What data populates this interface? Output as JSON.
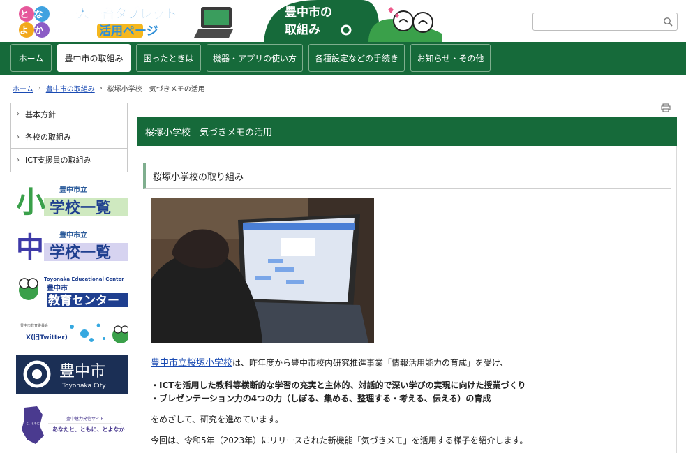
{
  "header": {
    "logo_left_top": "とな",
    "logo_left_bottom": "よか",
    "logo_main_top": "一人一台タブレット",
    "logo_main_bottom": "活用ページ",
    "badge_line1": "豊中市の",
    "badge_line2": "取組み",
    "search": {
      "value": "",
      "placeholder": ""
    }
  },
  "nav": {
    "items": [
      {
        "label": "ホーム"
      },
      {
        "label": "豊中市の取組み"
      },
      {
        "label": "困ったときは"
      },
      {
        "label": "機器・アプリの使い方"
      },
      {
        "label": "各種設定などの手続き"
      },
      {
        "label": "お知らせ・その他"
      }
    ]
  },
  "breadcrumb": {
    "home": "ホーム",
    "section": "豊中市の取組み",
    "current": "桜塚小学校　気づきメモの活用"
  },
  "sidebar": {
    "items": [
      {
        "label": "基本方針"
      },
      {
        "label": "各校の取組み"
      },
      {
        "label": "ICT支援員の取組み"
      }
    ],
    "banners": {
      "elem_kanji": "小",
      "elem_small": "豊中市立",
      "elem_big": "学校一覧",
      "jr_kanji": "中",
      "jr_small": "豊中市立",
      "jr_big": "学校一覧",
      "edu_en": "Toyonaka Educational Center",
      "edu_small": "豊中市",
      "edu_big": "教育センター",
      "x_small": "豊中市教育委員会",
      "x_label": "X(旧Twitter)",
      "city_jp": "豊中市",
      "city_en": "Toyonaka City",
      "attr_small": "豊中魅力発信サイト",
      "attr_big": "あなたと、ともに、とよなか",
      "attr_map": "と、ともに、とよなか"
    }
  },
  "main": {
    "title": "桜塚小学校　気づきメモの活用",
    "subheading": "桜塚小学校の取り組み",
    "intro_link": "豊中市立桜塚小学校",
    "intro_rest": "は、昨年度から豊中市校内研究推進事業「情報活用能力の育成」を受け、",
    "bullet1": "・ICTを活用した教科等横断的な学習の充実と主体的、対話的で深い学びの実現に向けた授業づくり",
    "bullet2": "・プレゼンテーション力の4つの力（しぼる、集める、整理する・考える、伝える）の育成",
    "para2": "をめざして、研究を進めています。",
    "para3": "今回は、令和5年（2023年）にリリースされた新機能「気づきメモ」を活用する様子を紹介します。"
  },
  "colors": {
    "brand_green": "#166a3a",
    "link_blue": "#1a4bb3"
  }
}
